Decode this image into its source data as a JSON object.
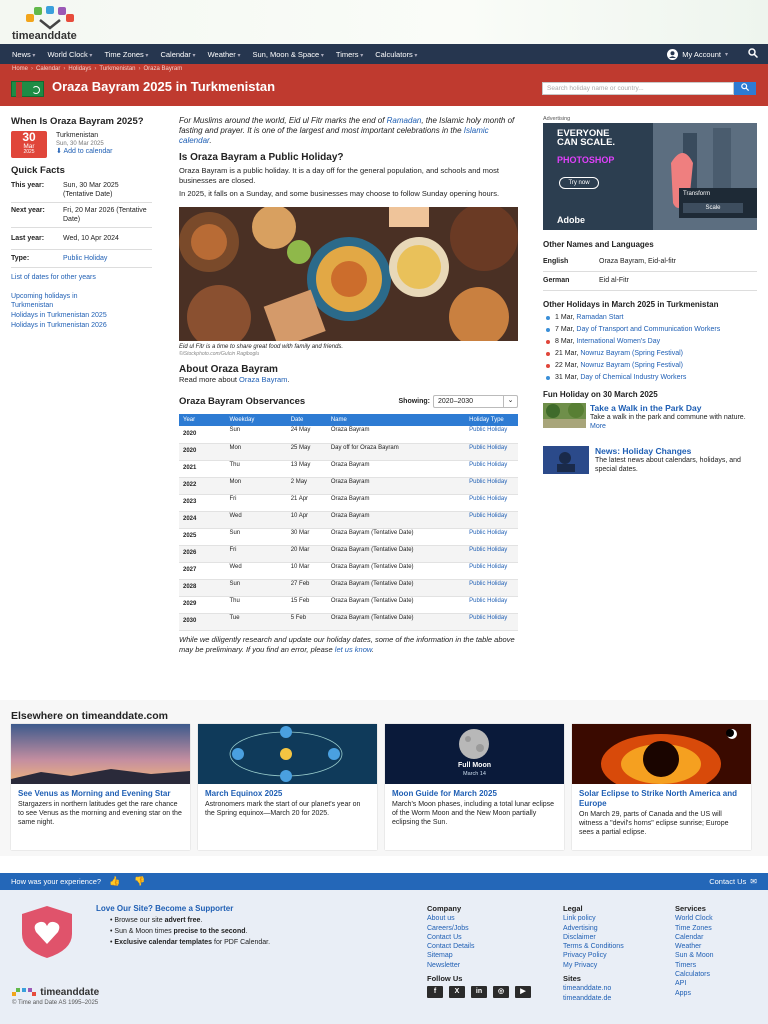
{
  "site": {
    "logo_text": "timeanddate"
  },
  "nav": {
    "items": [
      "News",
      "World Clock",
      "Time Zones",
      "Calendar",
      "Weather",
      "Sun, Moon & Space",
      "Timers",
      "Calculators"
    ],
    "account": "My Account"
  },
  "breadcrumb": [
    "Home",
    "Calendar",
    "Holidays",
    "Turkmenistan",
    "Oraza Bayram"
  ],
  "header": {
    "title": "Oraza Bayram 2025 in Turkmenistan",
    "search_placeholder": "Search holiday name or country..."
  },
  "left": {
    "heading": "When Is Oraza Bayram 2025?",
    "date_day": "30",
    "date_month": "Mar",
    "date_year": "2025",
    "country": "Turkmenistan",
    "date_full": "Sun, 30 Mar 2025",
    "add_calendar": "Add to calendar",
    "quick_facts": "Quick Facts",
    "facts": [
      {
        "k": "This year:",
        "v": "Sun, 30 Mar 2025 (Tentative Date)"
      },
      {
        "k": "Next year:",
        "v": "Fri, 20 Mar 2026 (Tentative Date)"
      },
      {
        "k": "Last year:",
        "v": "Wed, 10 Apr 2024"
      },
      {
        "k": "Type:",
        "v": "Public Holiday"
      }
    ],
    "list_dates": "List of dates for other years",
    "links": [
      "Upcoming holidays in Turkmenistan",
      "Holidays in Turkmenistan 2025",
      "Holidays in Turkmenistan 2026"
    ]
  },
  "main": {
    "intro_1": "For Muslims around the world, Eid ul Fitr marks the end of",
    "intro_link1": "Ramadan",
    "intro_2": ", the Islamic holy month of fasting and prayer. It is one of the largest and most important celebrations in the",
    "intro_link2": "Islamic calendar",
    "intro_3": ".",
    "q_heading": "Is Oraza Bayram a Public Holiday?",
    "q_p1": "Oraza Bayram is a public holiday. It is a day off for the general population, and schools and most businesses are closed.",
    "q_p2": "In 2025, it falls on a Sunday, and some businesses may choose to follow Sunday opening hours.",
    "img_caption": "Eid ul Fitr is a time to share great food with family and friends.",
    "img_credit": "©iStockphoto.com/Gulcin Ragiboglu",
    "about_heading": "About Oraza Bayram",
    "about_text": "Read more about",
    "about_link": "Oraza Bayram",
    "obs_heading": "Oraza Bayram Observances",
    "showing_label": "Showing:",
    "showing_value": "2020–2030",
    "table_headers": [
      "Year",
      "Weekday",
      "Date",
      "Name",
      "Holiday Type"
    ],
    "rows": [
      [
        "2020",
        "Sun",
        "24 May",
        "Oraza Bayram",
        "Public Holiday"
      ],
      [
        "2020",
        "Mon",
        "25 May",
        "Day off for Oraza Bayram",
        "Public Holiday"
      ],
      [
        "2021",
        "Thu",
        "13 May",
        "Oraza Bayram",
        "Public Holiday"
      ],
      [
        "2022",
        "Mon",
        "2 May",
        "Oraza Bayram",
        "Public Holiday"
      ],
      [
        "2023",
        "Fri",
        "21 Apr",
        "Oraza Bayram",
        "Public Holiday"
      ],
      [
        "2024",
        "Wed",
        "10 Apr",
        "Oraza Bayram",
        "Public Holiday"
      ],
      [
        "2025",
        "Sun",
        "30 Mar",
        "Oraza Bayram (Tentative Date)",
        "Public Holiday"
      ],
      [
        "2026",
        "Fri",
        "20 Mar",
        "Oraza Bayram (Tentative Date)",
        "Public Holiday"
      ],
      [
        "2027",
        "Wed",
        "10 Mar",
        "Oraza Bayram (Tentative Date)",
        "Public Holiday"
      ],
      [
        "2028",
        "Sun",
        "27 Feb",
        "Oraza Bayram (Tentative Date)",
        "Public Holiday"
      ],
      [
        "2029",
        "Thu",
        "15 Feb",
        "Oraza Bayram (Tentative Date)",
        "Public Holiday"
      ],
      [
        "2030",
        "Tue",
        "5 Feb",
        "Oraza Bayram (Tentative Date)",
        "Public Holiday"
      ]
    ],
    "disclaimer": "While we diligently research and update our holiday dates, some of the information in the table above may be preliminary. If you find an error, please",
    "disclaimer_link": "let us know",
    "disclaimer_end": "."
  },
  "right": {
    "ad_label": "Advertising",
    "ad_head": "EVERYONE CAN SCALE.",
    "ad_brand": "PHOTOSHOP",
    "ad_try": "Try now",
    "ad_transform": "Transform",
    "ad_scale": "Scale",
    "ad_adobe": "Adobe",
    "other_names_heading": "Other Names and Languages",
    "names": [
      {
        "k": "English",
        "v": "Oraza Bayram, Eid-al-fitr"
      },
      {
        "k": "German",
        "v": "Eid al-Fitr"
      }
    ],
    "other_holidays_heading": "Other Holidays in March 2025 in Turkmenistan",
    "holidays": [
      {
        "date": "1 Mar,",
        "name": "Ramadan Start",
        "color": "#3b8fd8"
      },
      {
        "date": "7 Mar,",
        "name": "Day of Transport and Communication Workers",
        "color": "#3b8fd8"
      },
      {
        "date": "8 Mar,",
        "name": "International Women's Day",
        "color": "#e0463a"
      },
      {
        "date": "21 Mar,",
        "name": "Nowruz Bayram (Spring Festival)",
        "color": "#e0463a"
      },
      {
        "date": "22 Mar,",
        "name": "Nowruz Bayram (Spring Festival)",
        "color": "#e0463a"
      },
      {
        "date": "31 Mar,",
        "name": "Day of Chemical Industry Workers",
        "color": "#3b8fd8"
      }
    ],
    "fun_heading": "Fun Holiday on 30 March 2025",
    "fun_title": "Take a Walk in the Park Day",
    "fun_text": "Take a walk in the park and commune with nature.",
    "fun_more": "More",
    "news_title": "News: Holiday Changes",
    "news_text": "The latest news about calendars, holidays, and special dates."
  },
  "elsewhere": {
    "heading": "Elsewhere on timeanddate.com",
    "cards": [
      {
        "title": "See Venus as Morning and Evening Star",
        "text": "Stargazers in northern latitudes get the rare chance to see Venus as the morning and evening star on the same night."
      },
      {
        "title": "March Equinox 2025",
        "text": "Astronomers mark the start of our planet's year on the Spring equinox—March 20 for 2025."
      },
      {
        "title": "Moon Guide for March 2025",
        "text": "March's Moon phases, including a total lunar eclipse of the Worm Moon and the New Moon partially eclipsing the Sun."
      },
      {
        "title": "Solar Eclipse to Strike North America and Europe",
        "text": "On March 29, parts of Canada and the US will witness a \"devil's horns\" eclipse sunrise; Europe sees a partial eclipse."
      }
    ],
    "card2_label": "Full Moon",
    "card2_sub": "March 14"
  },
  "feedback": {
    "question": "How was your experience?",
    "contact": "Contact Us"
  },
  "footer": {
    "support_title": "Love Our Site? Become a Supporter",
    "support_items": [
      {
        "pre": "Browse our site ",
        "b": "advert free",
        "post": "."
      },
      {
        "pre": "Sun & Moon times ",
        "b": "precise to the second",
        "post": "."
      },
      {
        "pre": "",
        "b": "Exclusive calendar templates",
        "post": " for PDF Calendar."
      }
    ],
    "copyright": "© Time and Date AS 1995–2025",
    "company_heading": "Company",
    "company": [
      "About us",
      "Careers/Jobs",
      "Contact Us",
      "Contact Details",
      "Sitemap",
      "Newsletter"
    ],
    "legal_heading": "Legal",
    "legal": [
      "Link policy",
      "Advertising",
      "Disclaimer",
      "Terms & Conditions",
      "Privacy Policy",
      "My Privacy"
    ],
    "services_heading": "Services",
    "services": [
      "World Clock",
      "Time Zones",
      "Calendar",
      "Weather",
      "Sun & Moon",
      "Timers",
      "Calculators",
      "API",
      "Apps"
    ],
    "follow_heading": "Follow Us",
    "social": [
      "f",
      "X",
      "in",
      "◎",
      "▶"
    ],
    "sites_heading": "Sites",
    "sites": [
      "timeanddate.no",
      "timeanddate.de"
    ]
  }
}
